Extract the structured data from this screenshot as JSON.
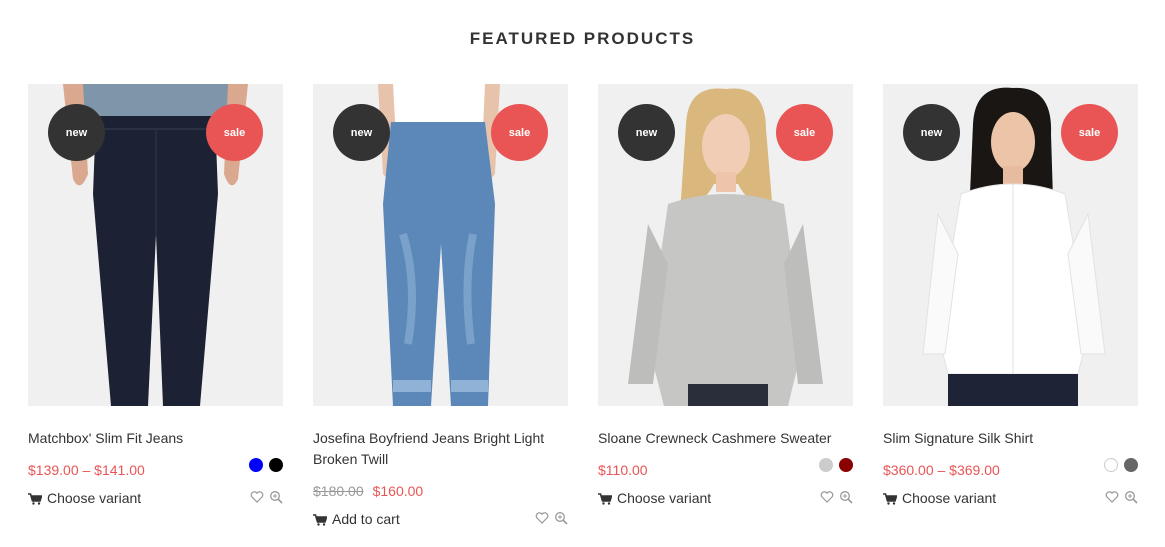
{
  "section": {
    "title": "FEATURED PRODUCTS"
  },
  "products": [
    {
      "title": "Matchbox' Slim Fit Jeans",
      "badge_new": "new",
      "badge_sale": "sale",
      "price": "$139.00 – $141.00",
      "price_old": "",
      "swatches": [
        "#0000ff",
        "#000000"
      ],
      "action": "Choose variant",
      "image": "dark-jeans"
    },
    {
      "title": "Josefina Boyfriend Jeans Bright Light Broken Twill",
      "badge_new": "new",
      "badge_sale": "sale",
      "price": "$160.00",
      "price_old": "$180.00",
      "swatches": [],
      "action": "Add to cart",
      "image": "light-jeans"
    },
    {
      "title": "Sloane Crewneck Cashmere Sweater",
      "badge_new": "new",
      "badge_sale": "sale",
      "price": "$110.00",
      "price_old": "",
      "swatches": [
        "#cccccc",
        "#8b0000"
      ],
      "action": "Choose variant",
      "image": "grey-sweater"
    },
    {
      "title": "Slim Signature Silk Shirt",
      "badge_new": "new",
      "badge_sale": "sale",
      "price": "$360.00 – $369.00",
      "price_old": "",
      "swatches": [
        "#ffffff",
        "#666666"
      ],
      "action": "Choose variant",
      "image": "white-shirt"
    }
  ],
  "colors": {
    "accent": "#e95555",
    "badge_new": "#333333",
    "text": "#333333"
  },
  "icons": [
    "cart-icon",
    "heart-icon",
    "zoom-icon"
  ]
}
